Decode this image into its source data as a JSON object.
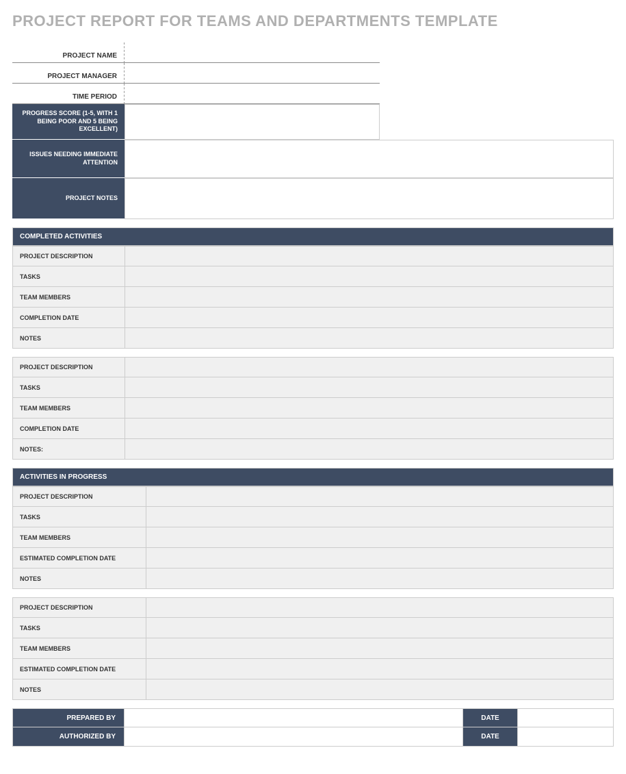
{
  "title": "PROJECT REPORT FOR TEAMS AND DEPARTMENTS TEMPLATE",
  "meta": {
    "project_name_label": "PROJECT NAME",
    "project_name_value": "",
    "project_manager_label": "PROJECT MANAGER",
    "project_manager_value": "",
    "time_period_label": "TIME PERIOD",
    "time_period_value": ""
  },
  "progress": {
    "score_label": "PROGRESS SCORE (1-5, WITH 1 BEING POOR AND 5 BEING EXCELLENT)",
    "score_value": "",
    "issues_label": "ISSUES NEEDING IMMEDIATE ATTENTION",
    "issues_value": "",
    "notes_label": "PROJECT NOTES",
    "notes_value": ""
  },
  "completed": {
    "header": "COMPLETED ACTIVITIES",
    "groups": [
      {
        "project_description_label": "PROJECT DESCRIPTION",
        "project_description_value": "",
        "tasks_label": "TASKS",
        "tasks_value": "",
        "team_members_label": "TEAM MEMBERS",
        "team_members_value": "",
        "completion_date_label": "COMPLETION DATE",
        "completion_date_value": "",
        "notes_label": "NOTES",
        "notes_value": ""
      },
      {
        "project_description_label": "PROJECT DESCRIPTION",
        "project_description_value": "",
        "tasks_label": "TASKS",
        "tasks_value": "",
        "team_members_label": "TEAM MEMBERS",
        "team_members_value": "",
        "completion_date_label": "COMPLETION DATE",
        "completion_date_value": "",
        "notes_label": "NOTES:",
        "notes_value": ""
      }
    ]
  },
  "in_progress": {
    "header": "ACTIVITIES IN PROGRESS",
    "groups": [
      {
        "project_description_label": "PROJECT DESCRIPTION",
        "project_description_value": "",
        "tasks_label": "TASKS",
        "tasks_value": "",
        "team_members_label": "TEAM MEMBERS",
        "team_members_value": "",
        "completion_date_label": "ESTIMATED COMPLETION DATE",
        "completion_date_value": "",
        "notes_label": "NOTES",
        "notes_value": ""
      },
      {
        "project_description_label": "PROJECT DESCRIPTION",
        "project_description_value": "",
        "tasks_label": "TASKS",
        "tasks_value": "",
        "team_members_label": "TEAM MEMBERS",
        "team_members_value": "",
        "completion_date_label": "ESTIMATED COMPLETION DATE",
        "completion_date_value": "",
        "notes_label": "NOTES",
        "notes_value": ""
      }
    ]
  },
  "footer": {
    "prepared_by_label": "PREPARED BY",
    "prepared_by_value": "",
    "prepared_date_label": "DATE",
    "prepared_date_value": "",
    "authorized_by_label": "AUTHORIZED BY",
    "authorized_by_value": "",
    "authorized_date_label": "DATE",
    "authorized_date_value": ""
  }
}
